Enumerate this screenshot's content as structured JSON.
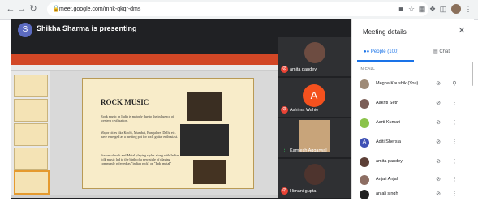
{
  "browser": {
    "url": "meet.google.com/mhk-qkqr-dms",
    "nav_icons": [
      "back-icon",
      "forward-icon",
      "reload-icon"
    ]
  },
  "presenter": {
    "avatar_letter": "S",
    "text": "Shikha Sharma is presenting"
  },
  "slide": {
    "title": "ROCK MUSIC",
    "bullets": [
      "Rock music in India is majorly due to the influence of western civilisation.",
      "Major cities like Kochi, Mumbai, Bangalore, Delhi etc. have emerged as a melting pot for rock guitar enthusiast.",
      "Fusion of rock and Metal playing styles along with Indian folk music led to the birth of a new style of playing commonly referred as \"indian rock\" or \"Indo metal\""
    ]
  },
  "tiles": [
    {
      "name": "amita pandey",
      "mic": "off",
      "kind": "face"
    },
    {
      "name": "Ashima Wahie",
      "mic": "off",
      "kind": "letter",
      "letter": "A"
    },
    {
      "name": "Kamlesh Aggarwal",
      "mic": "on",
      "kind": "video"
    },
    {
      "name": "Himani gupta",
      "mic": "off",
      "kind": "face"
    }
  ],
  "panel": {
    "title": "Meeting details",
    "tabs": {
      "people": "People (100)",
      "chat": "Chat"
    },
    "section_label": "IN CALL",
    "people": [
      {
        "name": "Megha Kaushik (You)",
        "avatar_color": "#9e8a76",
        "action": "pin-icon"
      },
      {
        "name": "Aakriti Seth",
        "avatar_color": "#7b5e57",
        "action": "more-icon"
      },
      {
        "name": "Aarti Kumari",
        "avatar_color": "#8bc34a",
        "action": "more-icon"
      },
      {
        "name": "Aditi Shersia",
        "avatar_color": "#3f51b5",
        "letter": "A",
        "action": "more-icon"
      },
      {
        "name": "amita pandey",
        "avatar_color": "#5d4037",
        "action": "more-icon"
      },
      {
        "name": "Anjali Anjali",
        "avatar_color": "#8d6e63",
        "action": "more-icon"
      },
      {
        "name": "anjali singh",
        "avatar_color": "#212121",
        "action": "more-icon"
      }
    ]
  },
  "colors": {
    "accent": "#1a73e8",
    "dark_bg": "#202124",
    "mic_off": "#ea4335",
    "mic_on": "#34a853",
    "ppt_ribbon": "#d24726"
  }
}
